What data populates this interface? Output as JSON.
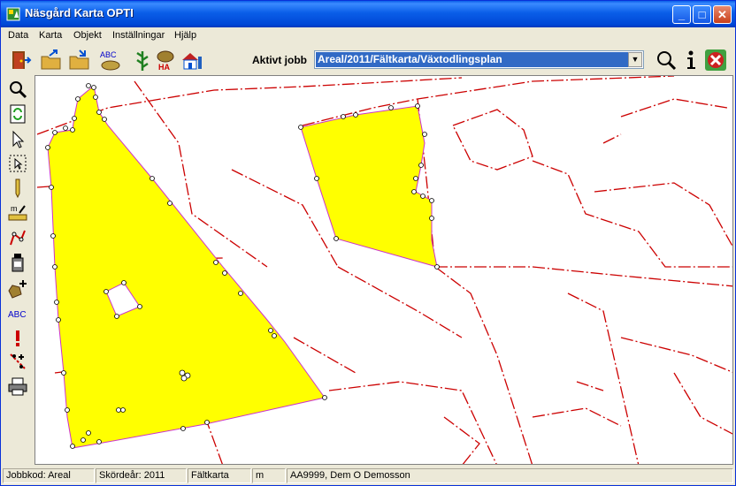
{
  "window": {
    "title": "Näsgård Karta OPTI",
    "controls": {
      "minimize": "_",
      "maximize": "□",
      "close": "✕"
    }
  },
  "menu": [
    "Data",
    "Karta",
    "Objekt",
    "Inställningar",
    "Hjälp"
  ],
  "toolbar": {
    "job_label": "Aktivt jobb",
    "job_value": "Areal/2011/Fältkarta/Växtodlingsplan",
    "abc_text": "ABC",
    "ha_text": "HA",
    "tools": [
      "door-exit-icon",
      "open-folder-icon",
      "save-folder-icon",
      "text-labels-icon",
      "crop-plant-icon",
      "hectare-icon",
      "farm-house-icon"
    ],
    "right_tools": [
      "zoom-icon",
      "info-icon",
      "close-map-icon"
    ]
  },
  "side_toolbar": {
    "abc_text": "ABC",
    "m_text": "m",
    "tools": [
      "zoom-icon",
      "refresh-icon",
      "select-arrow-icon",
      "select-area-icon",
      "pencil-icon",
      "measure-icon",
      "line-edit-icon",
      "sample-bottle-icon",
      "add-field-icon",
      "text-icon",
      "warning-icon",
      "split-icon",
      "print-icon"
    ]
  },
  "statusbar": {
    "jobbkod": "Jobbkod: Areal",
    "skordear": "Skördeår: 2011",
    "karta": "Fältkarta",
    "unit": "m",
    "user": "AA9999, Dem O Demosson"
  },
  "colors": {
    "field_fill": "#ffff00",
    "field_border": "#cc33cc",
    "map_lines": "#cc0000",
    "title_bar": "#0a5ee8",
    "selection": "#316ac5"
  }
}
